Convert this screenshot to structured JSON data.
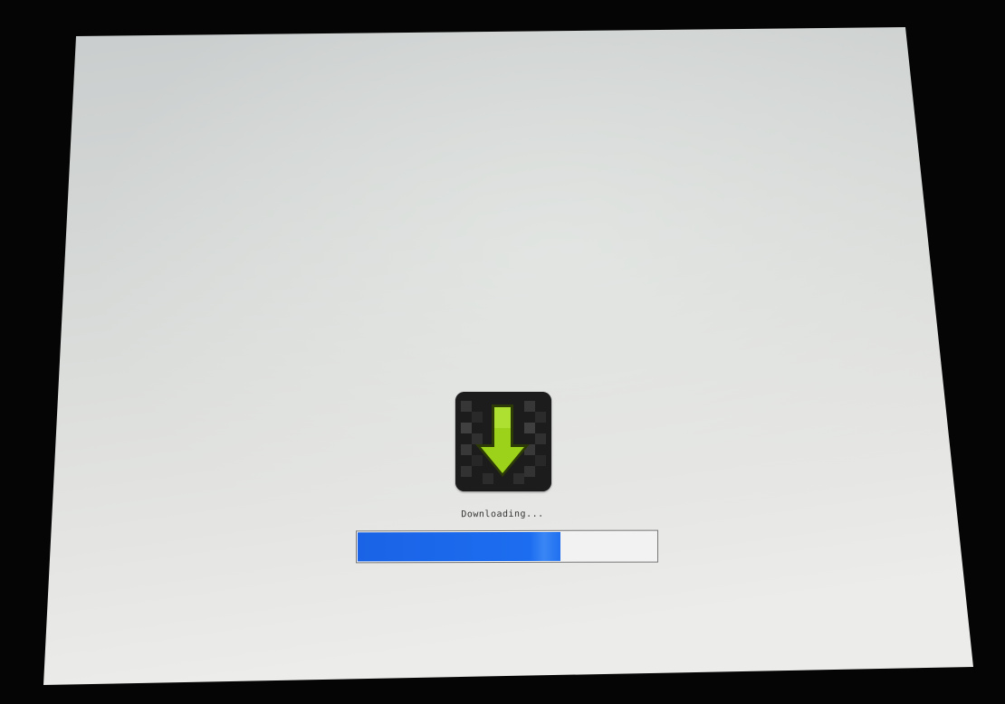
{
  "screen": {
    "status_text": "Downloading...",
    "progress_percent": 68,
    "colors": {
      "background": "#d8dada",
      "bezel": "#050505",
      "progress_fill": "#1d6df0",
      "progress_track": "#f2f2f2",
      "arrow": "#9cd21a",
      "icon_background": "#1e1e1e"
    },
    "icon": "download-arrow-icon"
  }
}
